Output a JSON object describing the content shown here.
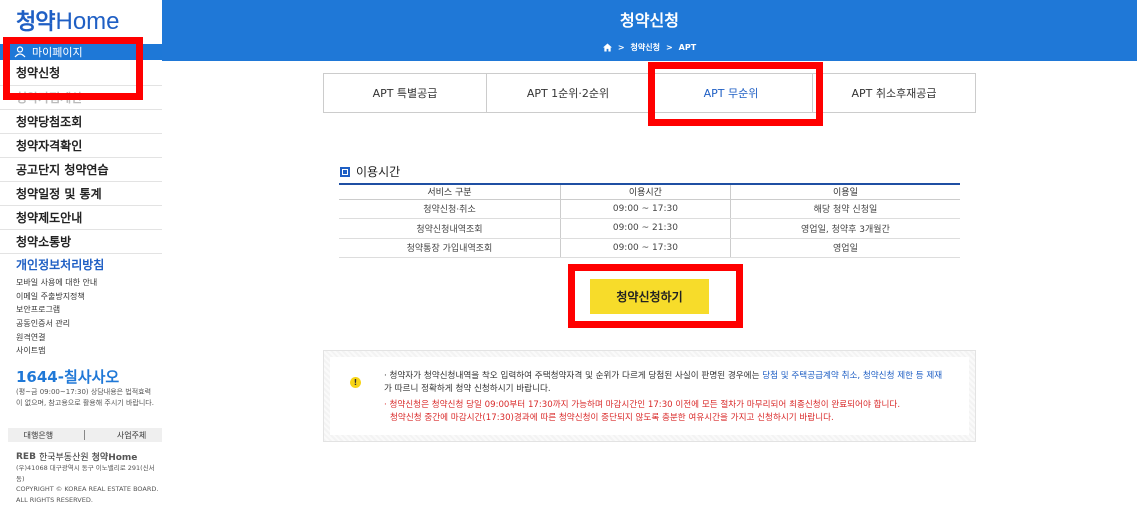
{
  "sidebar": {
    "logo_ko": "청약",
    "logo_en": "Home",
    "mypage": "마이페이지",
    "menu": [
      "청약신청",
      "청약가점계산",
      "청약당첨조회",
      "청약자격확인",
      "공고단지 청약연습",
      "청약일정 및 통계",
      "청약제도안내",
      "청약소통방"
    ],
    "privacy": "개인정보처리방침",
    "sublinks": [
      "모바일 사용에 대한 안내",
      "이메일 주출방지정책",
      "보안프로그램",
      "공동인증서 관리",
      "원격연결",
      "사이트맵"
    ],
    "phone": "1644-칠사사오",
    "phone_note": "(평~금 09:00~17:30) 상담내용은 법적효력이 없으며, 참고용으로 활용해 주시기 바랍니다.",
    "bank_label": "대행은행",
    "operator_label": "사업주체",
    "footer_brand": "REB",
    "footer_org": "한국부동산원",
    "footer_site": "청약Home",
    "footer_address": "(우)41068 대구광역시 동구 이노밸리로 291(신서동)",
    "footer_copyright": "COPYRIGHT © KOREA REAL ESTATE BOARD.",
    "footer_rights": "ALL RIGHTS RESERVED."
  },
  "header": {
    "title": "청약신청",
    "breadcrumb": [
      "청약신청",
      "APT"
    ]
  },
  "tabs": [
    {
      "label": "APT 특별공급",
      "active": false
    },
    {
      "label": "APT 1순위·2순위",
      "active": false
    },
    {
      "label": "APT 무순위",
      "active": true
    },
    {
      "label": "APT 취소후재공급",
      "active": false
    }
  ],
  "usage": {
    "title": "이용시간",
    "columns": [
      "서비스 구분",
      "이용시간",
      "이용일"
    ],
    "rows": [
      [
        "청약신청·취소",
        "09:00 ~ 17:30",
        "해당 청약 신청일"
      ],
      [
        "청약신청내역조회",
        "09:00 ~ 21:30",
        "영업일, 청약후 3개월간"
      ],
      [
        "청약통장 가입내역조회",
        "09:00 ~ 17:30",
        "영업일"
      ]
    ]
  },
  "apply_button": "청약신청하기",
  "notice": {
    "p1_a": "· 청약자가 청약신청내역을 착오 입력하여 주택청약자격 및 순위가 다르게 당첨된 사실이 판명된 경우에는 ",
    "p1_link": "당첨 및 주택공급계약 취소, 청약신청 제한 등 제재",
    "p1_b": "가 따르니 정확하게 청약 신청하시기 바랍니다.",
    "p2_a": "· 청약신청은 청약신청 당일 09:00부터 17:30까지 가능하며 마감시간인 17:30 이전에 모든 절차가 마무리되어 최종신청이 완료되어야 합니다.",
    "p2_b": "청약신청 중간에 마감시간(17:30)경과에 따른 청약신청이 중단되지 않도록 충분한 여유시간을 가지고 신청하시기 바랍니다."
  },
  "colors": {
    "primary": "#1f78d7",
    "highlight": "#ff0000",
    "button": "#f7dc2a",
    "warning_text": "#d92a2a"
  }
}
